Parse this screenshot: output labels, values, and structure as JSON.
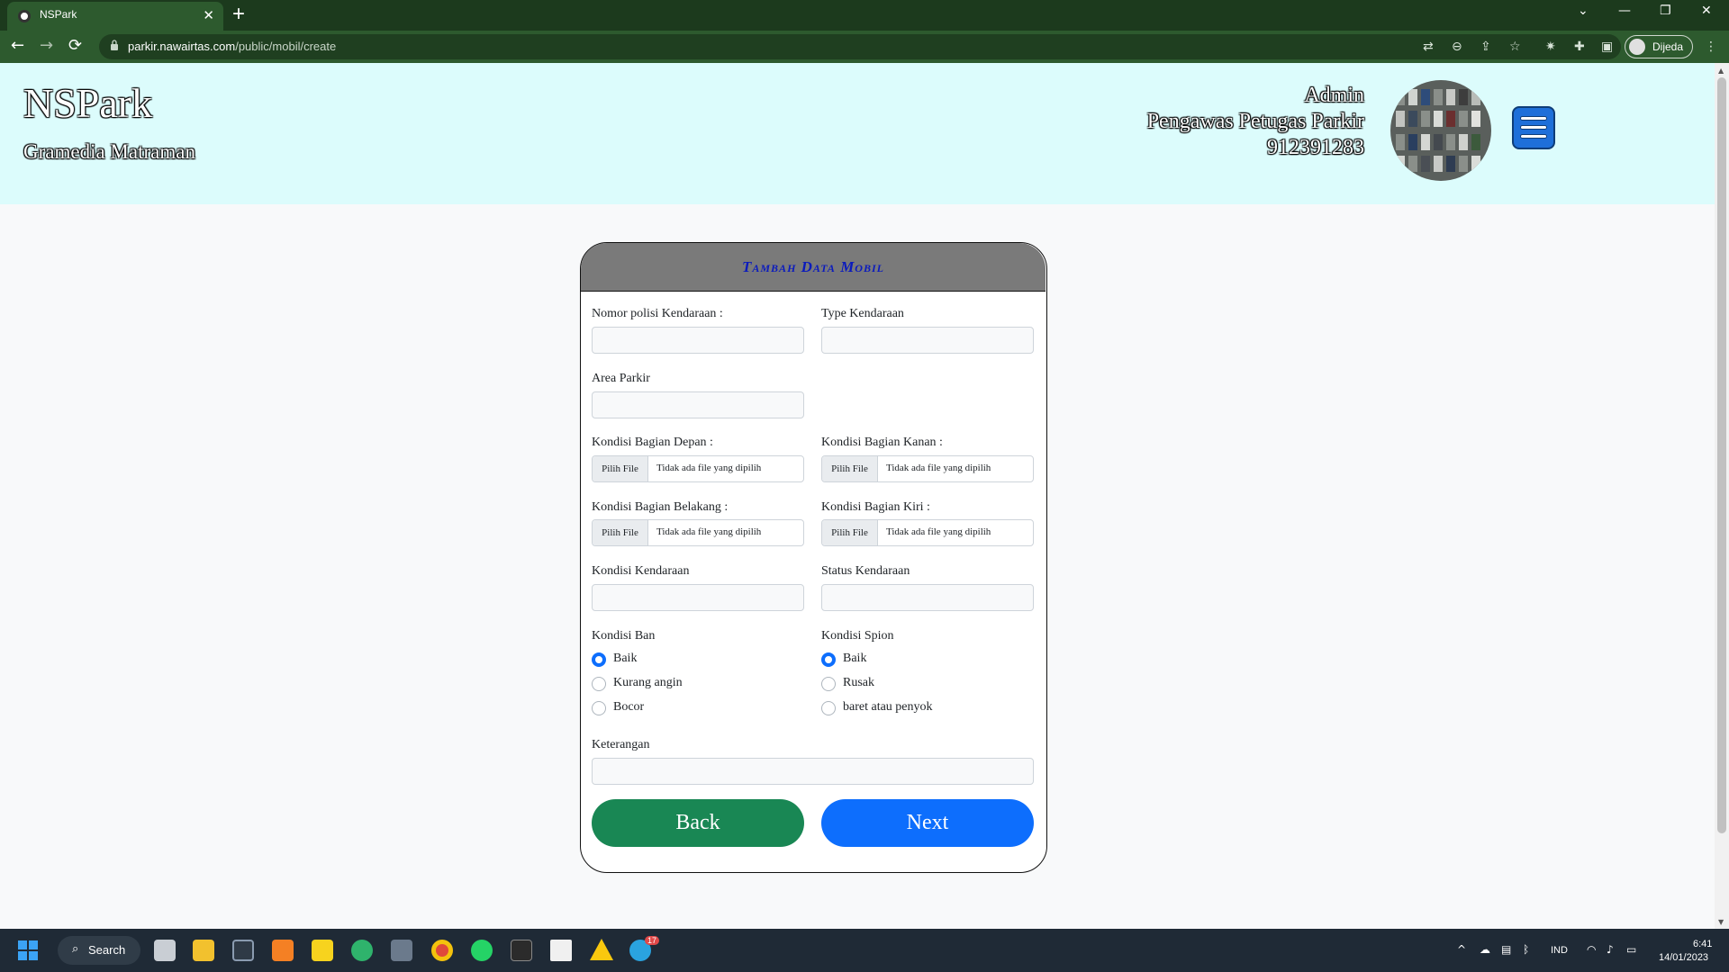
{
  "browser": {
    "tab_title": "NSPark",
    "tab_close": "✕",
    "new_tab": "+",
    "url_host": "parkir.nawairtas.com",
    "url_path": "/public/mobil/create",
    "profile_label": "Dijeda",
    "controls": {
      "dropdown": "⌄",
      "minimize": "—",
      "restore": "❐",
      "close": "✕"
    },
    "nav": {
      "back": "←",
      "forward": "→",
      "reload": "⟳"
    },
    "toolbar_icons": [
      "translate-icon",
      "zoom-icon",
      "share-icon",
      "bookmark-star-icon",
      "extension-icon",
      "puzzle-icon",
      "side-panel-icon",
      "menu-dots-icon"
    ],
    "theme_color": "#2d5a2e"
  },
  "header": {
    "brand": "NSPark",
    "location": "Gramedia Matraman",
    "user_name": "Admin",
    "user_role": "Pengawas Petugas Parkir",
    "user_phone": "912391283",
    "background": "#dcfcfc"
  },
  "form": {
    "title": "Tambah Data Mobil",
    "nomor_polisi_label": "Nomor polisi Kendaraan :",
    "nomor_polisi_value": "",
    "type_label": "Type Kendaraan",
    "type_value": "",
    "area_label": "Area Parkir",
    "area_value": "",
    "file_button": "Pilih File",
    "file_status": "Tidak ada file yang dipilih",
    "depan_label": "Kondisi Bagian Depan :",
    "kanan_label": "Kondisi Bagian Kanan :",
    "belakang_label": "Kondisi Bagian Belakang :",
    "kiri_label": "Kondisi Bagian Kiri :",
    "kondisi_kendaraan_label": "Kondisi Kendaraan",
    "kondisi_kendaraan_value": "",
    "status_kendaraan_label": "Status Kendaraan",
    "status_kendaraan_value": "",
    "ban_label": "Kondisi Ban",
    "ban_options": [
      "Baik",
      "Kurang angin",
      "Bocor"
    ],
    "ban_selected": "Baik",
    "spion_label": "Kondisi Spion",
    "spion_options": [
      "Baik",
      "Rusak",
      "baret atau penyok"
    ],
    "spion_selected": "Baik",
    "keterangan_label": "Keterangan",
    "keterangan_value": "",
    "back_label": "Back",
    "next_label": "Next",
    "back_color": "#198754",
    "next_color": "#0d6efd"
  },
  "taskbar": {
    "search_label": "Search",
    "search_icon": "⌕",
    "apps": [
      "task-view-icon",
      "file-explorer-icon",
      "app-icon",
      "xampp-icon",
      "sticky-notes-icon",
      "edge-icon",
      "calculator-icon",
      "chrome-icon",
      "whatsapp-icon",
      "terminal-icon",
      "file-icon",
      "warning-icon",
      "telegram-icon"
    ],
    "tray_chevron": "^",
    "language": "IND",
    "time": "6:41",
    "date": "14/01/2023",
    "telegram_badge": "17"
  }
}
